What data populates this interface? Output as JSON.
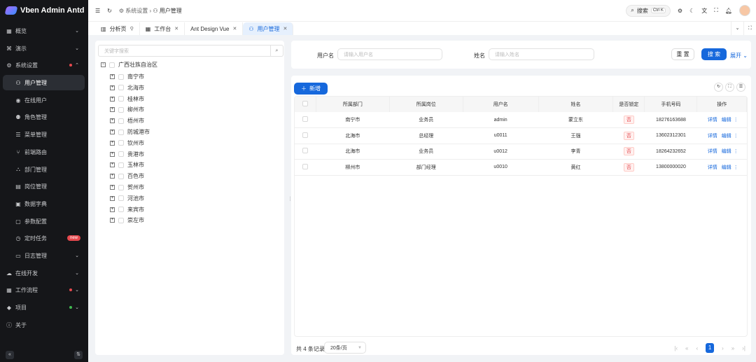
{
  "app": {
    "title": "Vben Admin Antd"
  },
  "sidebar": {
    "items": [
      {
        "label": "概览",
        "icon": "grid-icon",
        "chevron": "⌄"
      },
      {
        "label": "演示",
        "icon": "demo-icon",
        "chevron": "⌄"
      },
      {
        "label": "系统设置",
        "icon": "gear-icon",
        "chevron": "⌃",
        "dot": "#e5484d"
      },
      {
        "label": "用户管理",
        "icon": "user-icon",
        "sub": true,
        "active": true
      },
      {
        "label": "在线用户",
        "icon": "eye-icon",
        "sub": true
      },
      {
        "label": "角色管理",
        "icon": "role-icon",
        "sub": true
      },
      {
        "label": "菜单管理",
        "icon": "menu-icon",
        "sub": true
      },
      {
        "label": "前端路由",
        "icon": "branch-icon",
        "sub": true
      },
      {
        "label": "部门管理",
        "icon": "org-icon",
        "sub": true
      },
      {
        "label": "岗位管理",
        "icon": "post-icon",
        "sub": true
      },
      {
        "label": "数据字典",
        "icon": "book-icon",
        "sub": true
      },
      {
        "label": "参数配置",
        "icon": "config-icon",
        "sub": true
      },
      {
        "label": "定时任务",
        "icon": "clock-icon",
        "sub": true,
        "badge": "new"
      },
      {
        "label": "日志管理",
        "icon": "log-icon",
        "sub": true,
        "chevron": "⌄"
      },
      {
        "label": "在线开发",
        "icon": "cloud-icon",
        "chevron": "⌄"
      },
      {
        "label": "工作流程",
        "icon": "flow-icon",
        "chevron": "⌄",
        "dot": "#e5484d"
      },
      {
        "label": "项目",
        "icon": "project-icon",
        "chevron": "⌄",
        "dot": "#3fb950"
      },
      {
        "label": "关于",
        "icon": "info-icon"
      }
    ]
  },
  "header": {
    "breadcrumb": [
      "系统设置",
      "用户管理"
    ],
    "search_label": "搜索",
    "search_shortcut": "Ctrl K"
  },
  "tabs": [
    {
      "label": "分析页",
      "icon": "chart-icon",
      "pinned": true
    },
    {
      "label": "工作台",
      "icon": "desk-icon"
    },
    {
      "label": "Ant Design Vue"
    },
    {
      "label": "用户管理",
      "icon": "user-icon",
      "active": true
    }
  ],
  "tree": {
    "search_placeholder": "关键字搜索",
    "root": "广西壮族自治区",
    "children": [
      "南宁市",
      "北海市",
      "桂林市",
      "柳州市",
      "梧州市",
      "防城港市",
      "钦州市",
      "贵港市",
      "玉林市",
      "百色市",
      "贺州市",
      "河池市",
      "来宾市",
      "崇左市"
    ]
  },
  "form": {
    "username_label": "用户名",
    "username_placeholder": "请输入用户名",
    "name_label": "姓名",
    "name_placeholder": "请输入姓名",
    "reset": "重 置",
    "search": "搜 索",
    "expand": "展开"
  },
  "table": {
    "add": "新增",
    "columns": [
      "所属部门",
      "所属岗位",
      "用户名",
      "姓名",
      "是否锁定",
      "手机号码",
      "操作"
    ],
    "rows": [
      [
        "南宁市",
        "业务员",
        "admin",
        "蒙立东",
        "否",
        "18276163688"
      ],
      [
        "北海市",
        "总经理",
        "u0011",
        "王强",
        "否",
        "13602312301"
      ],
      [
        "北海市",
        "业务员",
        "u0012",
        "李青",
        "否",
        "18264232652"
      ],
      [
        "柳州市",
        "部门经理",
        "u0010",
        "黄红",
        "否",
        "13800000020"
      ]
    ],
    "detail": "详情",
    "edit": "编辑"
  },
  "pagination": {
    "total": "共 4 条记录",
    "page_size": "20条/页",
    "current": "1"
  }
}
